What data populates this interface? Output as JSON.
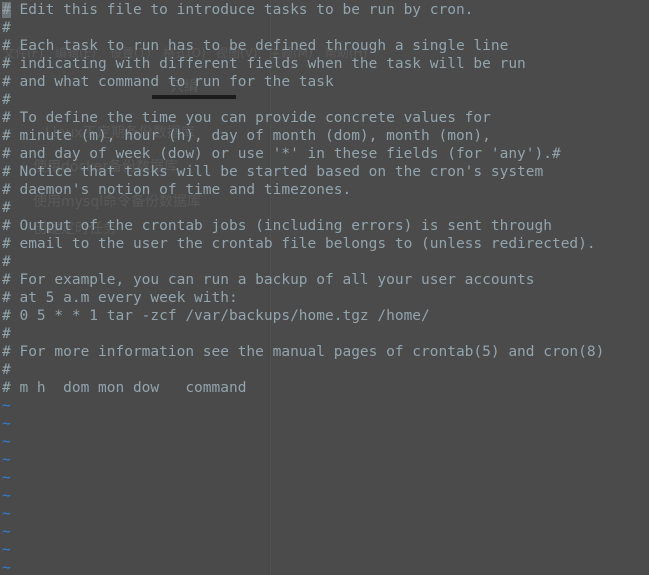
{
  "window": {
    "title": "crontab",
    "app": "vim",
    "background_color": "#4a4a4a",
    "text_color": "#92a4ae",
    "tilde_color": "#2f7fd8",
    "ghost_color": "#5e5e5e"
  },
  "editor": {
    "mode": "normal",
    "cursor": {
      "line": 1,
      "column": 1,
      "char": "#"
    },
    "lines": [
      "# Edit this file to introduce tasks to be run by cron.",
      "#",
      "# Each task to run has to be defined through a single line",
      "# indicating with different fields when the task will be run",
      "# and what command to run for the task",
      "#",
      "# To define the time you can provide concrete values for",
      "# minute (m), hour (h), day of month (dom), month (mon),",
      "# and day of week (dow) or use '*' in these fields (for 'any').#",
      "# Notice that tasks will be started based on the cron's system",
      "# daemon's notion of time and timezones.",
      "#",
      "# Output of the crontab jobs (including errors) is sent through",
      "# email to the user the crontab file belongs to (unless redirected).",
      "#",
      "# For example, you can run a backup of all your user accounts",
      "# at 5 a.m every week with:",
      "# 0 5 * * 1 tar -zcf /var/backups/home.tgz /home/",
      "#",
      "# For more information see the manual pages of crontab(5) and cron(8)",
      "#",
      "# m h  dom mon dow   command"
    ],
    "empty_line_marker": "~",
    "empty_line_count": 10
  },
  "ghost_overlay": {
    "description": "faint bleed-through text from an underlying window",
    "menu_items": [
      "文件(F)",
      "编辑(E)",
      "设置(T)",
      "格式(O)",
      "视图(V)",
      "主题(M)",
      "帮助(H)"
    ],
    "headings": [
      "文件",
      "只绢"
    ],
    "list_items": [
      "Linux下定期备份数据库",
      "使用docker备份数据库",
      "使用mysql命令备份数据库",
      "创建定时任务"
    ]
  }
}
